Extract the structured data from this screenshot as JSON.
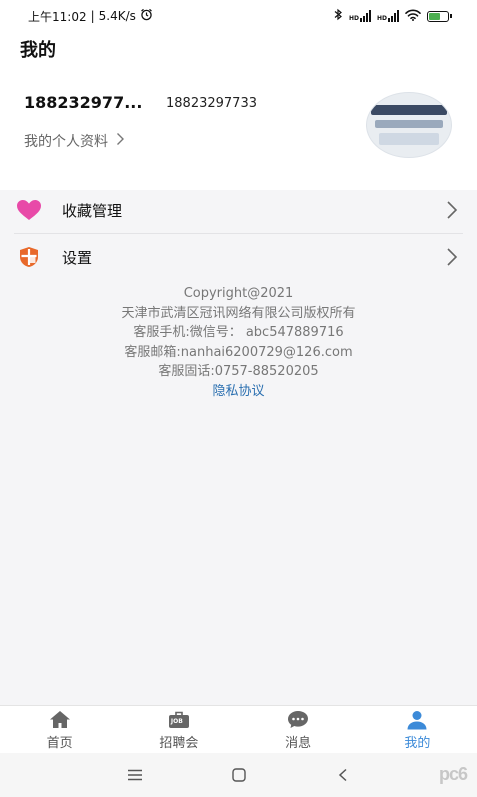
{
  "status_bar": {
    "time": "上午11:02",
    "separator": "|",
    "speed": "5.4K/s",
    "icons": [
      "alarm-icon",
      "bluetooth-icon",
      "signal-hd-icon",
      "signal-hd-icon",
      "wifi-icon",
      "battery-icon"
    ],
    "signal_label": "HD"
  },
  "header": {
    "title": "我的",
    "user_name": "188232977...",
    "user_phone": "18823297733",
    "profile_link": "我的个人资料"
  },
  "menu": {
    "items": [
      {
        "label": "收藏管理",
        "icon": "heart-icon",
        "color": "#e84aa8"
      },
      {
        "label": "设置",
        "icon": "shield-icon",
        "color": "#e8692b"
      }
    ]
  },
  "footer": {
    "copyright": "Copyright@2021",
    "company": "天津市武清区冠讯网络有限公司版权所有",
    "phone": "客服手机:微信号： abc547889716",
    "email": "客服邮箱:nanhai6200729@126.com",
    "tel": "客服固话:0757-88520205",
    "privacy": "隐私协议"
  },
  "tabbar": {
    "tabs": [
      {
        "label": "首页",
        "icon": "home-icon",
        "active": false
      },
      {
        "label": "招聘会",
        "icon": "job-icon",
        "active": false
      },
      {
        "label": "消息",
        "icon": "message-icon",
        "active": false
      },
      {
        "label": "我的",
        "icon": "user-icon",
        "active": true
      }
    ],
    "job_badge": "JOB"
  },
  "nav": {
    "buttons": [
      "menu-icon",
      "home-square-icon",
      "back-icon"
    ]
  },
  "watermark": "pc6",
  "colors": {
    "accent": "#3c8ad8",
    "privacy_link": "#2a6fb0"
  }
}
